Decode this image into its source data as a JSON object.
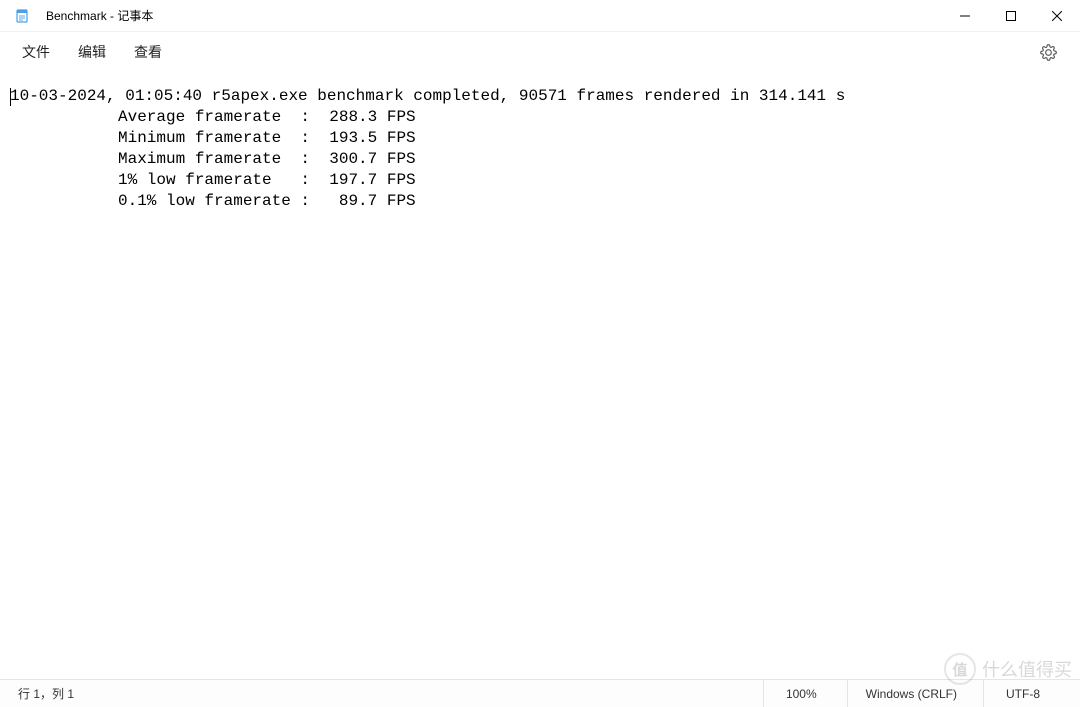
{
  "titlebar": {
    "title": "Benchmark - 记事本"
  },
  "menu": {
    "file": "文件",
    "edit": "编辑",
    "view": "查看"
  },
  "content": {
    "line1": "10-03-2024, 01:05:40 r5apex.exe benchmark completed, 90571 frames rendered in 314.141 s",
    "line2": "Average framerate  :  288.3 FPS",
    "line3": "Minimum framerate  :  193.5 FPS",
    "line4": "Maximum framerate  :  300.7 FPS",
    "line5": "1% low framerate   :  197.7 FPS",
    "line6": "0.1% low framerate :   89.7 FPS"
  },
  "statusbar": {
    "position": "行 1，列 1",
    "zoom": "100%",
    "eol": "Windows (CRLF)",
    "encoding": "UTF-8"
  },
  "watermark": {
    "badge": "值",
    "text": "什么值得买"
  }
}
